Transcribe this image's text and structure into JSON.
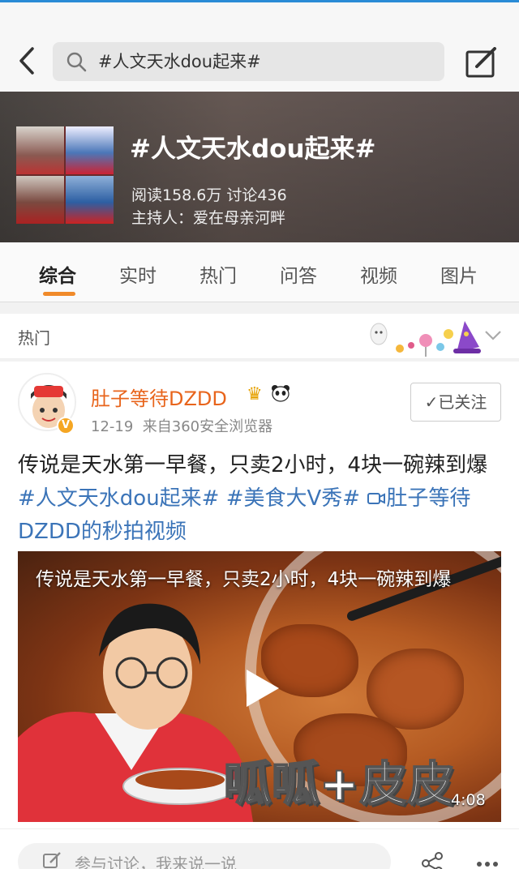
{
  "search": {
    "query": "#人文天水dou起来#"
  },
  "topic": {
    "title": "#人文天水dou起来#",
    "stats": "阅读158.6万  讨论436",
    "host": "主持人：爱在母亲河畔"
  },
  "tabs": [
    {
      "label": "综合",
      "active": true
    },
    {
      "label": "实时"
    },
    {
      "label": "热门"
    },
    {
      "label": "问答"
    },
    {
      "label": "视频"
    },
    {
      "label": "图片"
    }
  ],
  "section": {
    "title": "热门"
  },
  "post": {
    "author": "肚子等待DZDD",
    "time": "12-19",
    "source": "来自360安全浏览器",
    "follow_label": "✓已关注",
    "text_plain": "传说是天水第一早餐，只卖2小时，4块一碗辣到爆",
    "hashtag1": "#人文天水dou起来#",
    "hashtag2": "#美食大V秀#",
    "video_link": "肚子等待DZDD的秒拍视频",
    "video": {
      "caption": "传说是天水第一早餐，只卖2小时，4块一碗辣到爆",
      "sticker": "呱呱+皮皮",
      "duration": "4:08"
    }
  },
  "comment": {
    "placeholder": "参与讨论，我来说一说"
  },
  "colors": {
    "accent": "#f08a2a",
    "author": "#e8641b",
    "link": "#3b74b8"
  },
  "icons": [
    "back-icon",
    "search-icon",
    "edit-icon",
    "chevron-down-icon",
    "play-icon",
    "video-link-icon",
    "share-icon",
    "more-icon"
  ]
}
